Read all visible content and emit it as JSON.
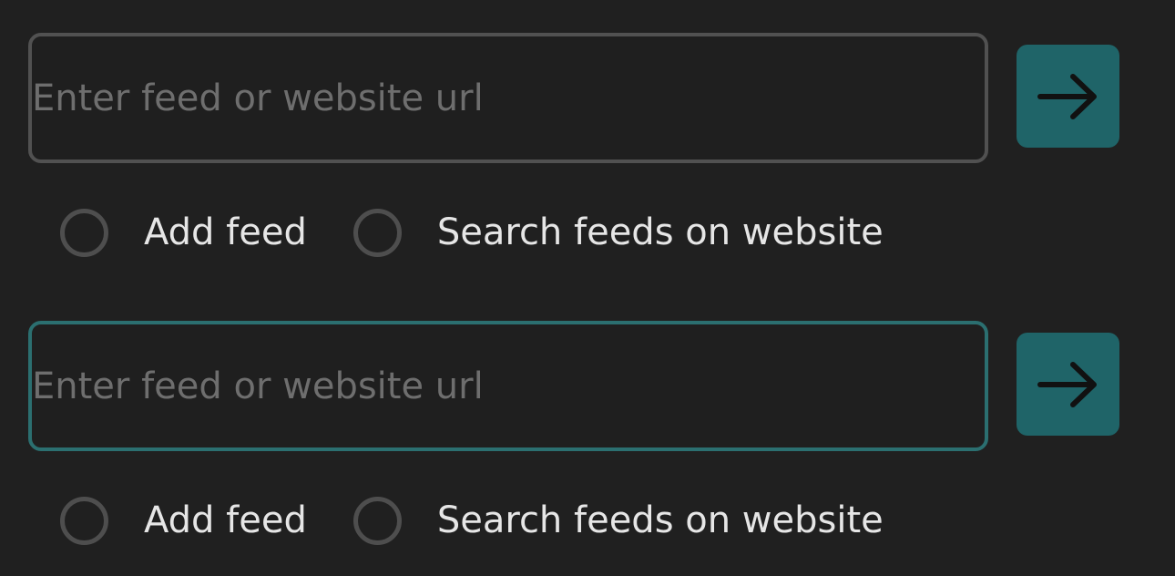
{
  "colors": {
    "background": "#202020",
    "input_border": "#515151",
    "input_border_focused": "#2b6f70",
    "placeholder": "#6e6e6e",
    "button": "#1f6468",
    "radio_border": "#4e4e4e",
    "label": "#e6e6e6"
  },
  "forms": [
    {
      "state": "default",
      "input": {
        "placeholder": "Enter feed or website url",
        "value": ""
      },
      "submit_icon": "arrow-right-icon",
      "options": [
        {
          "label": "Add feed",
          "selected": false
        },
        {
          "label": "Search feeds on website",
          "selected": false
        }
      ]
    },
    {
      "state": "focused",
      "input": {
        "placeholder": "Enter feed or website url",
        "value": ""
      },
      "submit_icon": "arrow-right-icon",
      "options": [
        {
          "label": "Add feed",
          "selected": false
        },
        {
          "label": "Search feeds on website",
          "selected": false
        }
      ]
    }
  ]
}
